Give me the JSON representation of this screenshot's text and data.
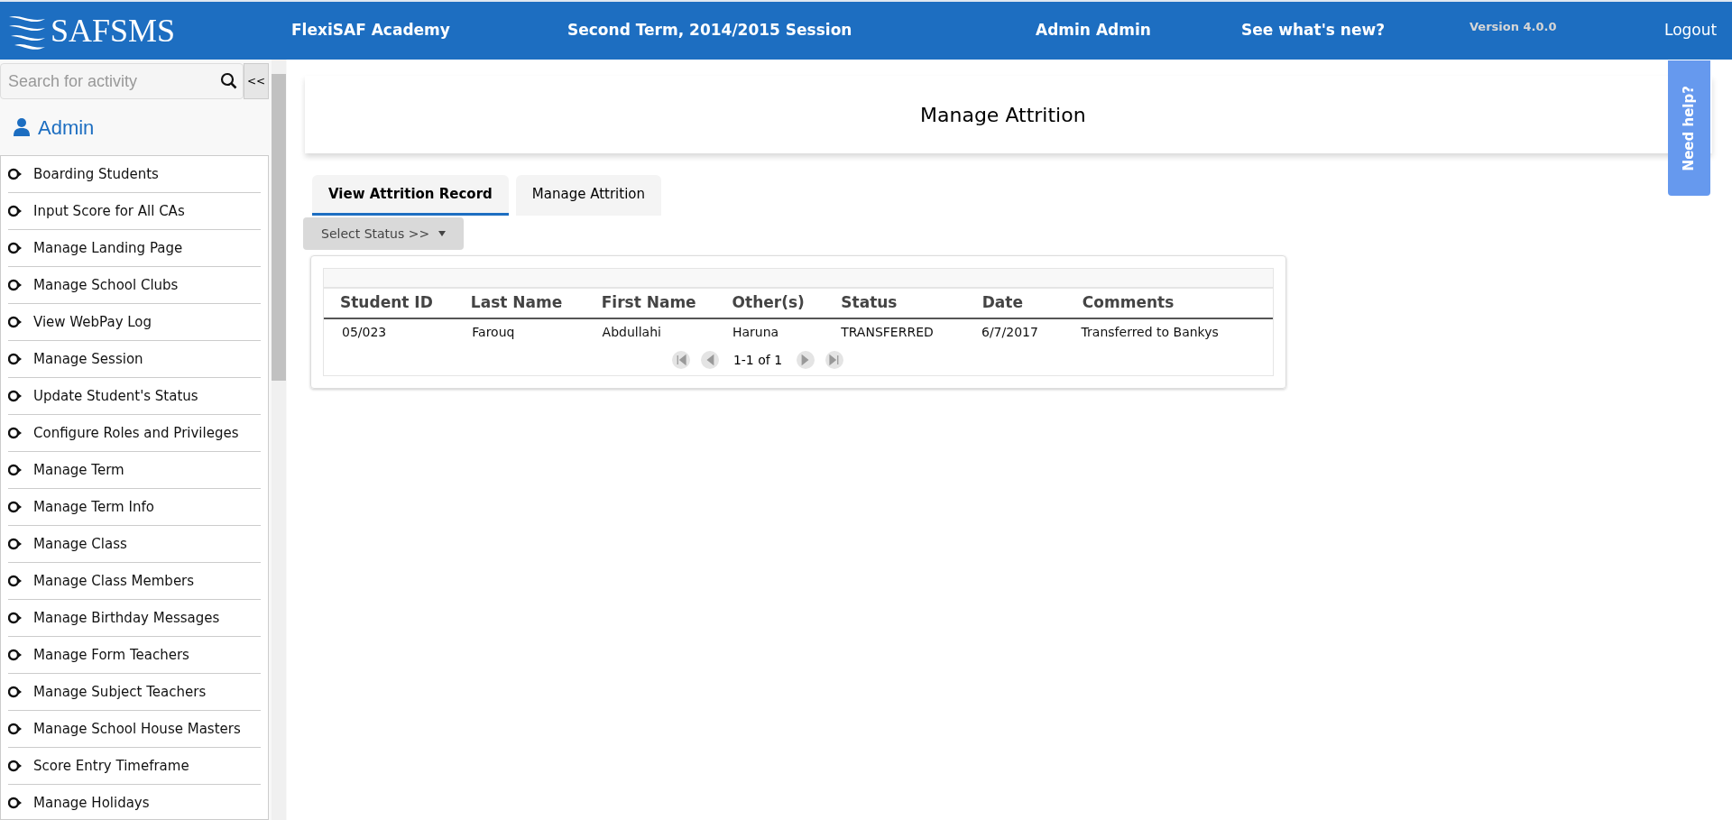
{
  "header": {
    "logo": "SAFSMS",
    "school": "FlexiSAF Academy",
    "session": "Second Term, 2014/2015 Session",
    "user": "Admin Admin",
    "whats_new": "See what's new?",
    "version": "Version 4.0.0",
    "logout": "Logout"
  },
  "sidebar": {
    "search_placeholder": "Search for activity",
    "collapse": "<<",
    "role": "Admin",
    "items": [
      {
        "label": "Boarding Students"
      },
      {
        "label": "Input Score for All CAs"
      },
      {
        "label": "Manage Landing Page"
      },
      {
        "label": "Manage School Clubs"
      },
      {
        "label": "View WebPay Log"
      },
      {
        "label": "Manage Session"
      },
      {
        "label": "Update Student's Status"
      },
      {
        "label": "Configure Roles and Privileges"
      },
      {
        "label": "Manage Term"
      },
      {
        "label": "Manage Term Info"
      },
      {
        "label": "Manage Class"
      },
      {
        "label": "Manage Class Members"
      },
      {
        "label": "Manage Birthday Messages"
      },
      {
        "label": "Manage Form Teachers"
      },
      {
        "label": "Manage Subject Teachers"
      },
      {
        "label": "Manage School House Masters"
      },
      {
        "label": "Score Entry Timeframe"
      },
      {
        "label": "Manage Holidays"
      }
    ]
  },
  "page_title": "Manage Attrition",
  "help_tab": "Need help?",
  "tabs": [
    {
      "label": "View Attrition Record",
      "selected": true
    },
    {
      "label": "Manage Attrition",
      "selected": false
    }
  ],
  "status_select": "Select Status >>",
  "table": {
    "columns": [
      "Student ID",
      "Last Name",
      "First Name",
      "Other(s)",
      "Status",
      "Date",
      "Comments"
    ],
    "rows": [
      [
        "05/023",
        "Farouq",
        "Abdullahi",
        "Haruna",
        "TRANSFERRED",
        "6/7/2017",
        "Transferred to Bankys"
      ]
    ],
    "pagination": "1-1 of 1"
  }
}
